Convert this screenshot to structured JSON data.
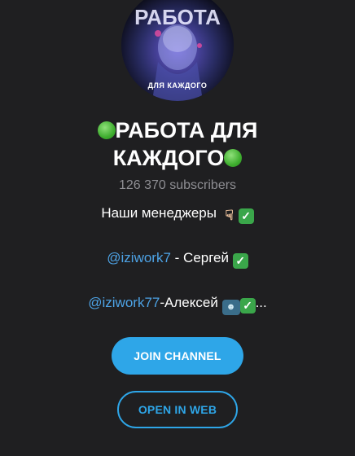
{
  "channel": {
    "avatar_text": "РАБОТА",
    "avatar_caption": "ДЛЯ КАЖДОГО",
    "title_line1": "РАБОТА ДЛЯ",
    "title_line2": "КАЖДОГО",
    "subscribers": "126 370 subscribers"
  },
  "description": {
    "line1_text": "Наши менеджеры ",
    "line2_link": "@iziwork7",
    "line2_text": " - Сергей ",
    "line3_link": "@iziwork77",
    "line3_text": "-Алексей ",
    "line3_tail": "..."
  },
  "buttons": {
    "join": "JOIN CHANNEL",
    "open_web": "OPEN IN WEB"
  },
  "colors": {
    "background": "#1f1f21",
    "accent": "#2ea6e8",
    "link": "#4da3e6",
    "muted": "#8e8e93"
  },
  "icons": {
    "title_emoji": "green-circle-icon",
    "hand_emoji": "pointing-down-hand-icon",
    "check_emoji": "check-mark-icon",
    "person_emoji": "person-at-computer-icon"
  }
}
